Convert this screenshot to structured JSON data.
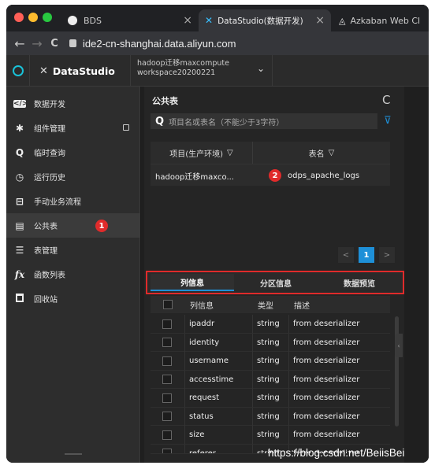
{
  "browser": {
    "tabs": [
      {
        "label": "BDS",
        "close": "×"
      },
      {
        "label": "DataStudio(数据开发)",
        "close": "×"
      },
      {
        "label": "Azkaban Web Cl",
        "close": ""
      }
    ],
    "nav": {
      "back": "←",
      "forward": "→",
      "reload": "C"
    },
    "url": "ide2-cn-shanghai.data.aliyun.com"
  },
  "app": {
    "brand": "DataStudio",
    "workspace_line1": "hadoop迁移maxcompute",
    "workspace_line2": "workspace20200221",
    "dropdown_caret": "⌄"
  },
  "sidebar": {
    "items": [
      {
        "label": "数据开发",
        "icon": "code-icon",
        "glyph": "</>"
      },
      {
        "label": "组件管理",
        "icon": "component-icon",
        "glyph": "✱",
        "lock": "🔒"
      },
      {
        "label": "临时查询",
        "icon": "search-icon",
        "glyph": "Q"
      },
      {
        "label": "运行历史",
        "icon": "history-icon",
        "glyph": "◷"
      },
      {
        "label": "手动业务流程",
        "icon": "briefcase-icon",
        "glyph": "⊟"
      },
      {
        "label": "公共表",
        "icon": "table-icon",
        "glyph": "▤",
        "badge": "1"
      },
      {
        "label": "表管理",
        "icon": "table-manage-icon",
        "glyph": "☰"
      },
      {
        "label": "函数列表",
        "icon": "function-icon",
        "glyph": "fx"
      },
      {
        "label": "回收站",
        "icon": "trash-icon",
        "glyph": "🗑"
      }
    ]
  },
  "main": {
    "title": "公共表",
    "refresh": "C",
    "search_placeholder": "项目名或表名（不能少于3字符）",
    "filter_icon": "filter-icon",
    "columns": [
      "项目(生产环境)",
      "表名"
    ],
    "row": {
      "project": "hadoop迁移maxco...",
      "table": "odps_apache_logs",
      "badge": "2"
    },
    "pager": {
      "prev": "<",
      "current": "1",
      "next": ">"
    },
    "detail_tabs": [
      "列信息",
      "分区信息",
      "数据预览"
    ],
    "detail_headers": [
      "列信息",
      "类型",
      "描述"
    ],
    "detail_rows": [
      {
        "name": "ipaddr",
        "type": "string",
        "desc": "from deserializer"
      },
      {
        "name": "identity",
        "type": "string",
        "desc": "from deserializer"
      },
      {
        "name": "username",
        "type": "string",
        "desc": "from deserializer"
      },
      {
        "name": "accesstime",
        "type": "string",
        "desc": "from deserializer"
      },
      {
        "name": "request",
        "type": "string",
        "desc": "from deserializer"
      },
      {
        "name": "status",
        "type": "string",
        "desc": "from deserializer"
      },
      {
        "name": "size",
        "type": "string",
        "desc": "from deserializer"
      },
      {
        "name": "referer",
        "type": "string",
        "desc": "from deserializer"
      }
    ]
  },
  "watermark": "https://blog.csdn.net/BeiisBei",
  "colors": {
    "accent": "#1e90d8",
    "highlight_border": "#e02b2b",
    "badge": "#e02b2b"
  }
}
